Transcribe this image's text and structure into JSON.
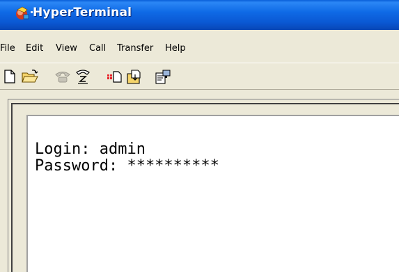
{
  "window": {
    "title": "HyperTerminal"
  },
  "menu": [
    {
      "label": "File"
    },
    {
      "label": "Edit"
    },
    {
      "label": "View"
    },
    {
      "label": "Call"
    },
    {
      "label": "Transfer"
    },
    {
      "label": "Help"
    }
  ],
  "toolbar": [
    {
      "icon": "new-document-icon"
    },
    {
      "icon": "open-folder-icon"
    },
    {
      "icon": "call-phone-icon"
    },
    {
      "icon": "disconnect-icon"
    },
    {
      "icon": "send-icon"
    },
    {
      "icon": "receive-icon"
    },
    {
      "icon": "properties-icon"
    }
  ],
  "terminal": {
    "lines": [
      "Login: admin",
      "Password: **********"
    ]
  },
  "colors": {
    "titlebar": "#0a5fd9",
    "chrome": "#ece9d8",
    "terminal_bg": "#ffffff",
    "text": "#000000"
  }
}
